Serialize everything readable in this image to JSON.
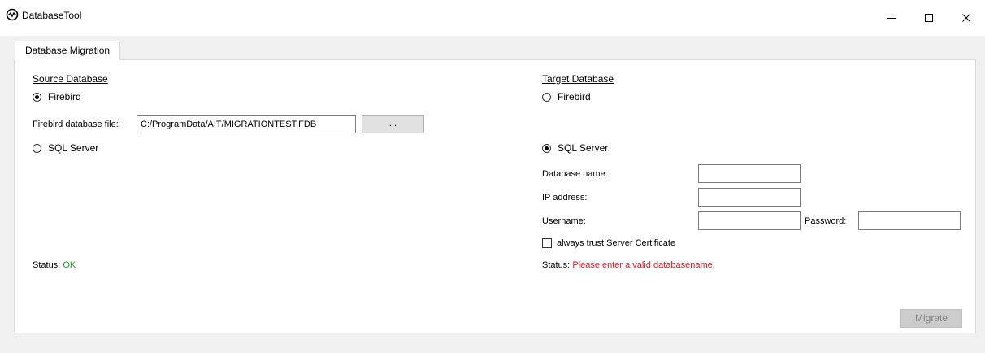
{
  "window": {
    "title": "DatabaseTool",
    "minimize_icon": "minimize-icon",
    "maximize_icon": "maximize-icon",
    "close_icon": "close-icon"
  },
  "tabs": [
    {
      "label": "Database Migration",
      "selected": true
    }
  ],
  "source": {
    "title": "Source Database",
    "firebird_label": "Firebird",
    "firebird_selected": true,
    "file_label": "Firebird database file:",
    "file_value": "C:/ProgramData/AIT/MIGRATIONTEST.FDB",
    "browse_label": "...",
    "sqlserver_label": "SQL Server",
    "sqlserver_selected": false,
    "status_label": "Status:",
    "status_value": "OK",
    "status_color": "#1f9e22"
  },
  "target": {
    "title": "Target Database",
    "firebird_label": "Firebird",
    "firebird_selected": false,
    "sqlserver_label": "SQL Server",
    "sqlserver_selected": true,
    "dbname_label": "Database name:",
    "dbname_value": "",
    "ip_label": "IP address:",
    "ip_value": "",
    "username_label": "Username:",
    "username_value": "",
    "password_label": "Password:",
    "password_value": "",
    "trust_label": "always trust Server Certificate",
    "trust_checked": false,
    "status_label": "Status:",
    "status_value": "Please enter a valid databasename.",
    "status_color": "#e81123"
  },
  "actions": {
    "migrate_label": "Migrate",
    "migrate_enabled": false
  }
}
